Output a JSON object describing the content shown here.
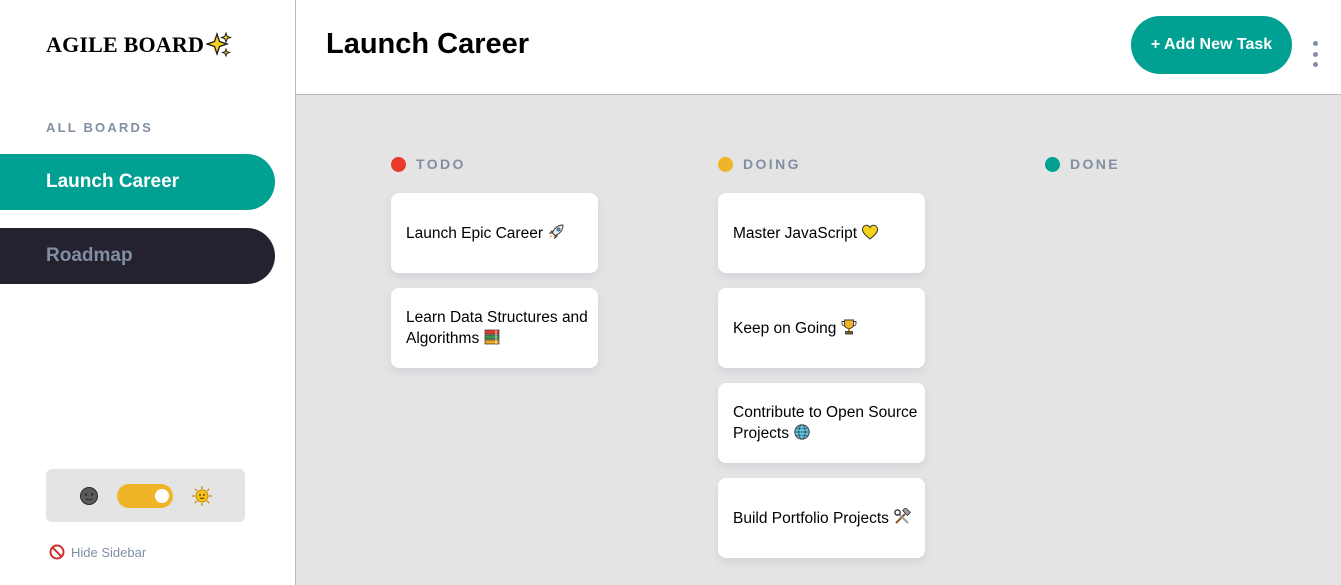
{
  "sidebar": {
    "logo_text": "AGILE BOARD",
    "logo_icon": "sparkles-icon",
    "boards_heading": "ALL BOARDS",
    "boards": [
      {
        "label": "Launch Career",
        "active": true
      },
      {
        "label": "Roadmap",
        "active": false
      }
    ],
    "theme": {
      "dark_icon": "new-moon-face-icon",
      "light_icon": "sun-face-icon",
      "toggle_on": true
    },
    "hide_sidebar_label": "Hide Sidebar",
    "hide_sidebar_icon": "no-entry-icon"
  },
  "header": {
    "title": "Launch Career",
    "add_task_label": "+ Add New Task",
    "menu_icon": "kebab-menu-icon"
  },
  "columns": [
    {
      "name": "TODO",
      "color": "#e8392a",
      "cards": [
        {
          "text": "Launch Epic Career",
          "icon": "rocket-icon"
        },
        {
          "text": "Learn Data Structures and Algorithms",
          "icon": "books-icon"
        }
      ]
    },
    {
      "name": "DOING",
      "color": "#f0b429",
      "cards": [
        {
          "text": "Master JavaScript",
          "icon": "yellow-heart-icon"
        },
        {
          "text": "Keep on Going",
          "icon": "trophy-icon"
        },
        {
          "text": "Contribute to Open Source Projects",
          "icon": "globe-icon"
        },
        {
          "text": "Build Portfolio Projects",
          "icon": "hammer-and-wrench-icon"
        }
      ]
    },
    {
      "name": "DONE",
      "color": "#00a093",
      "cards": []
    }
  ],
  "colors": {
    "accent": "#00a093",
    "sidebar_inactive_bg": "#23222e",
    "muted_text": "#828fa3",
    "board_bg": "#e4e4e4"
  }
}
